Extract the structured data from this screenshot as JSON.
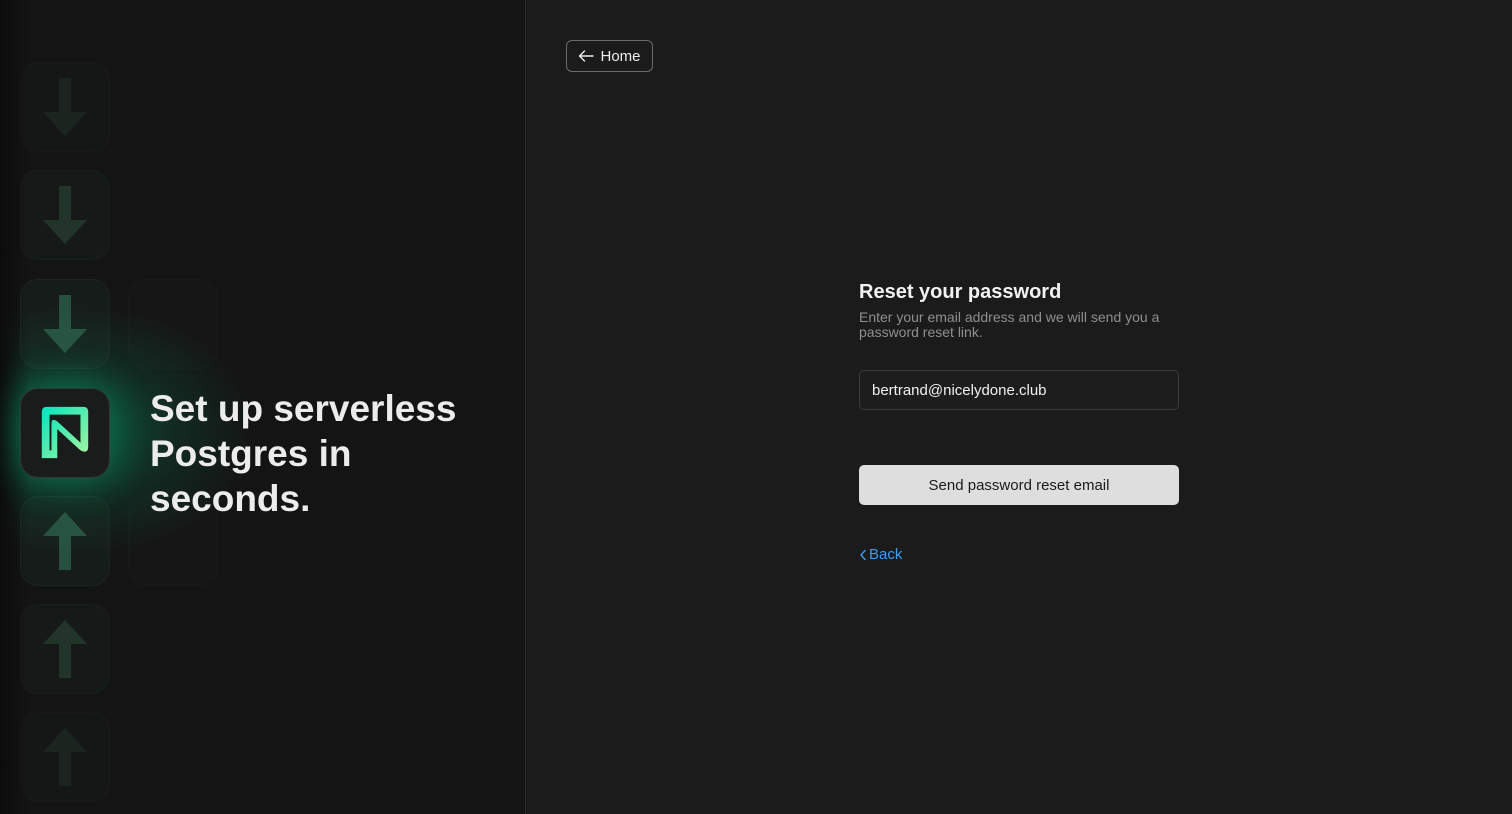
{
  "brand": {
    "tagline_line1": "Set up serverless",
    "tagline_line2": "Postgres in seconds.",
    "logo_icon": "neon-logo-icon",
    "accent_color": "#00e599"
  },
  "nav": {
    "home_label": "Home",
    "home_icon": "arrow-left-icon"
  },
  "form": {
    "title": "Reset your password",
    "subtitle": "Enter your email address and we will send you a password reset link.",
    "email_value": "bertrand@nicelydone.club",
    "submit_label": "Send password reset email",
    "back_label": "Back",
    "back_icon": "chevron-left-icon",
    "link_color": "#3b9cf5"
  },
  "decor": {
    "tile_icons": [
      "arrow-down-icon",
      "arrow-down-icon",
      "arrow-down-icon",
      "arrow-up-icon",
      "arrow-up-icon",
      "arrow-up-icon"
    ]
  }
}
